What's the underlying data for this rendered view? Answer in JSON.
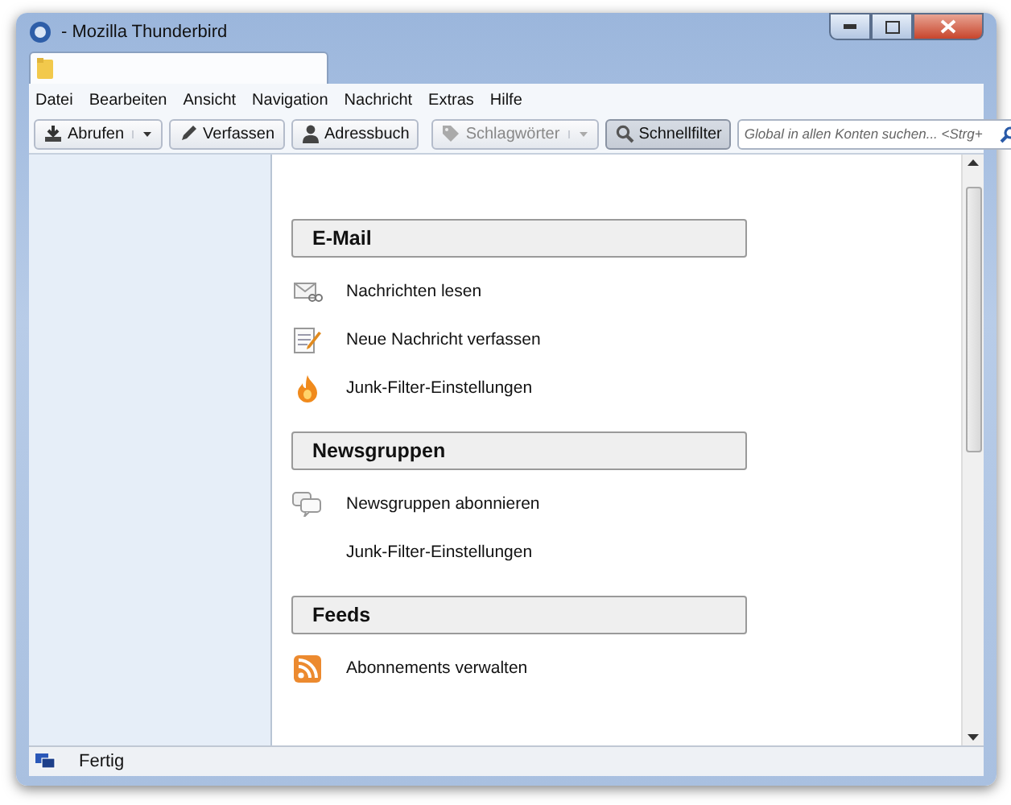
{
  "window": {
    "title": "- Mozilla Thunderbird"
  },
  "tabs": [
    {
      "selected": true
    }
  ],
  "menu": [
    "Datei",
    "Bearbeiten",
    "Ansicht",
    "Navigation",
    "Nachricht",
    "Extras",
    "Hilfe"
  ],
  "toolbar": [
    {
      "kind": "split",
      "label": "Abrufen",
      "disabled": false,
      "selected": false
    },
    {
      "kind": "button",
      "label": "Verfassen",
      "disabled": false,
      "selected": false
    },
    {
      "kind": "button",
      "label": "Adressbuch",
      "disabled": false,
      "selected": false
    },
    {
      "kind": "separator"
    },
    {
      "kind": "dropdown",
      "label": "Schlagwörter",
      "disabled": true,
      "selected": false
    },
    {
      "kind": "button",
      "label": "Schnellfilter",
      "disabled": false,
      "selected": true
    }
  ],
  "search": {
    "placeholder": "Global in allen Konten suchen... <Strg+"
  },
  "sections": [
    {
      "title": "E-Mail",
      "items": [
        {
          "kind": "read",
          "label": "Nachrichten lesen"
        },
        {
          "kind": "compose",
          "label": "Neue Nachricht verfassen"
        },
        {
          "kind": "junk",
          "label": "Junk-Filter-Einstellungen"
        }
      ]
    },
    {
      "title": "Newsgruppen",
      "items": [
        {
          "kind": "news",
          "label": "Newsgruppen abonnieren"
        },
        {
          "kind": "plain",
          "label": "Junk-Filter-Einstellungen"
        }
      ]
    },
    {
      "title": "Feeds",
      "items": [
        {
          "kind": "rss",
          "label": "Abonnements verwalten"
        }
      ]
    }
  ],
  "status_bar": {
    "text": "Fertig"
  }
}
